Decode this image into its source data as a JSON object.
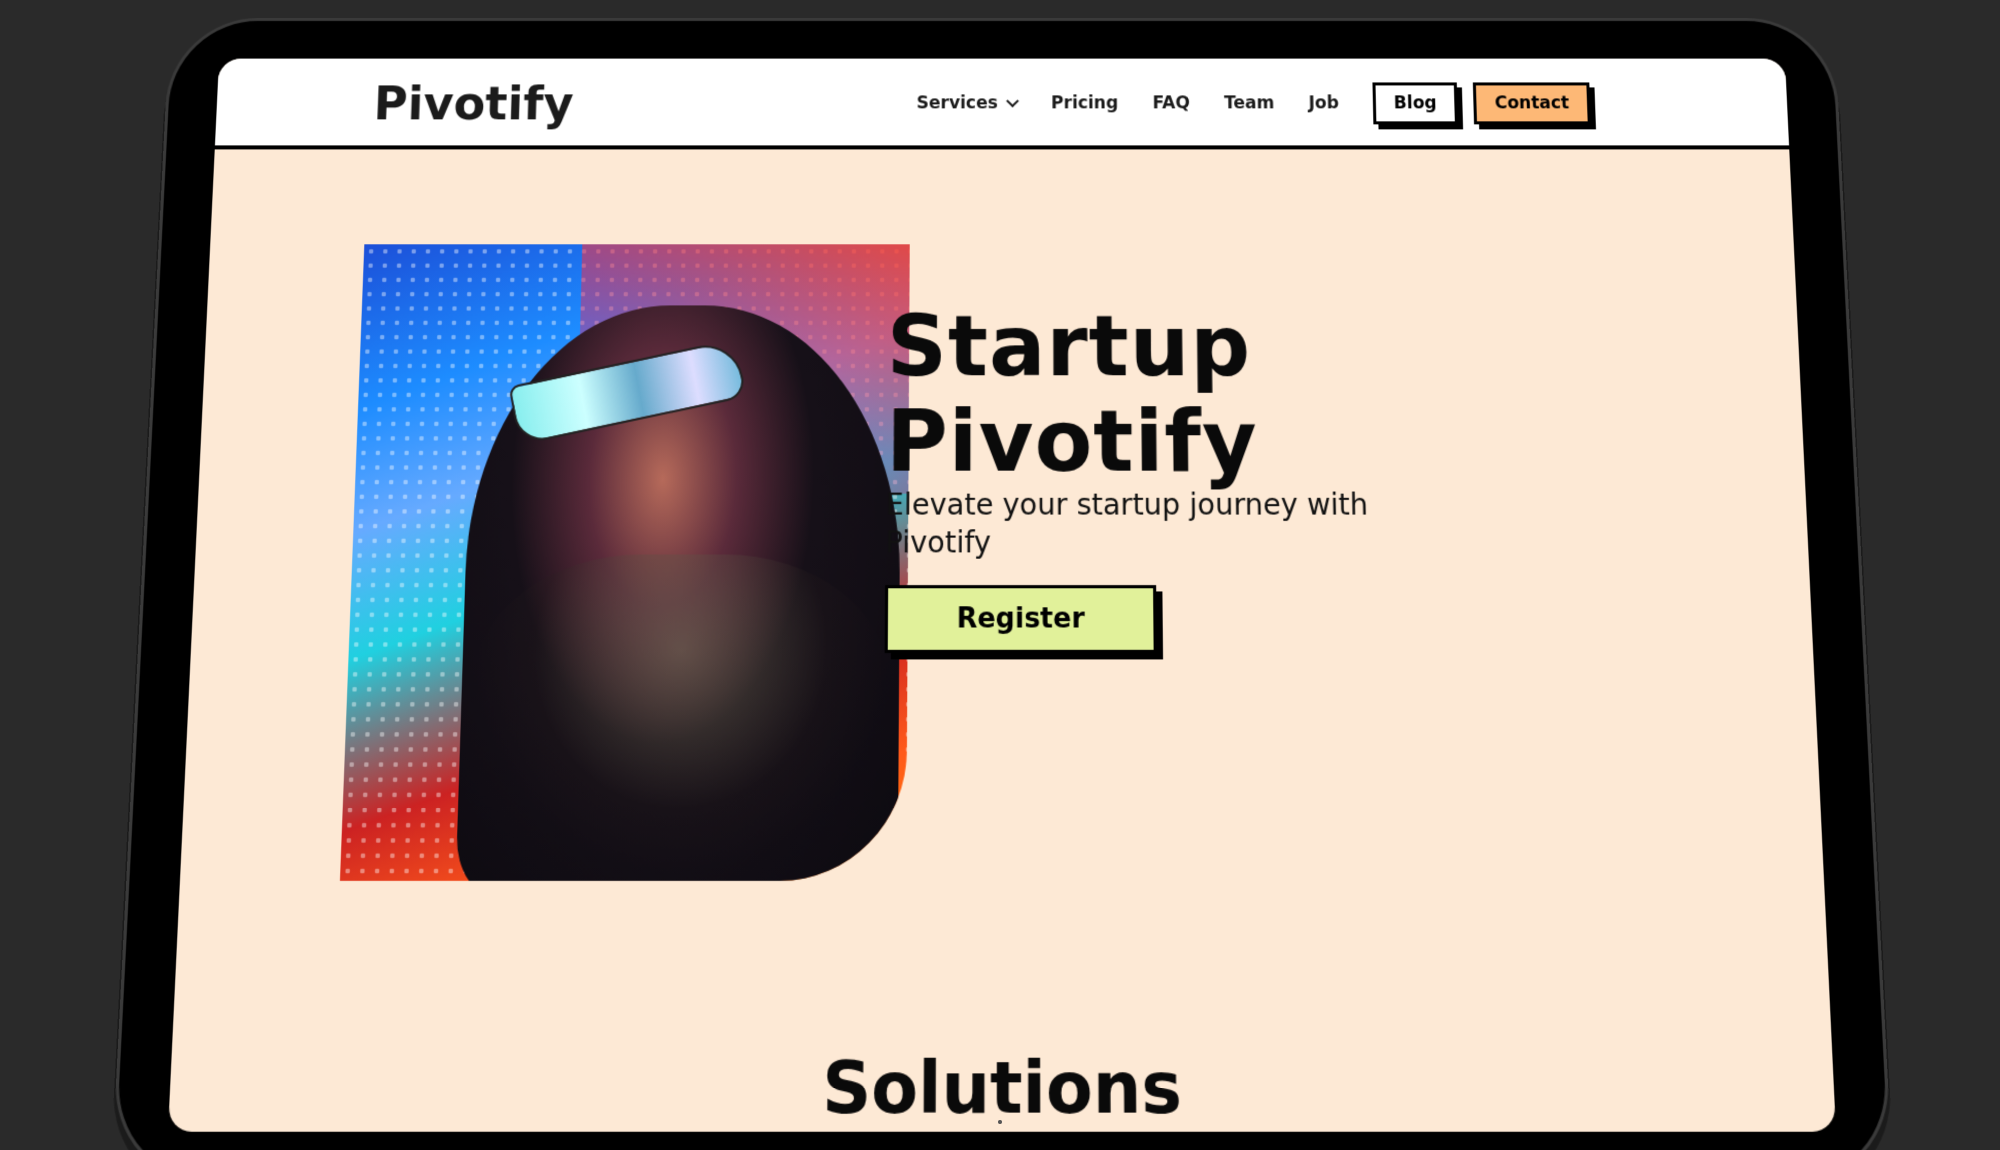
{
  "brand": {
    "logo_text": "Pivotify"
  },
  "nav": {
    "items": [
      {
        "label": "Services",
        "has_dropdown": true
      },
      {
        "label": "Pricing"
      },
      {
        "label": "FAQ"
      },
      {
        "label": "Team"
      },
      {
        "label": "Job"
      }
    ],
    "blog_label": "Blog",
    "contact_label": "Contact"
  },
  "hero": {
    "title_line1": "Startup",
    "title_line2": "Pivotify",
    "subtitle": "Elevate your startup journey with Pivotify",
    "register_label": "Register",
    "image_alt_icon": "photo-person-neon-visor"
  },
  "sections": {
    "solutions_title": "Solutions"
  },
  "colors": {
    "background": "#2a2a2a",
    "page_bg": "#fde9d5",
    "header_bg": "#ffffff",
    "contact_btn": "#fdb876",
    "register_btn": "#e1f19a",
    "text": "#0a0a0a"
  }
}
